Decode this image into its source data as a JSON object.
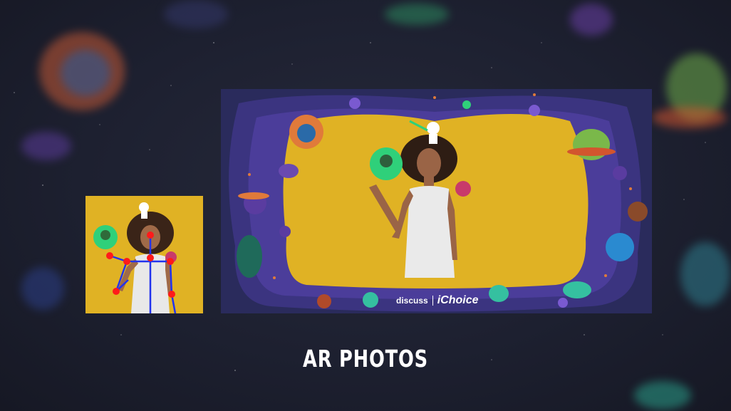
{
  "title": "AR PHOTOS",
  "brand": {
    "discuss": "discuss",
    "ichoice": "iChoice"
  },
  "colors": {
    "background": "#1c1e2b",
    "yellow_backdrop": "#e0b224",
    "frame_purple": "#2a2b5c",
    "skeleton_joint": "#ff1a1a",
    "skeleton_line": "#2233ee",
    "accent_green": "#2fd07a"
  }
}
